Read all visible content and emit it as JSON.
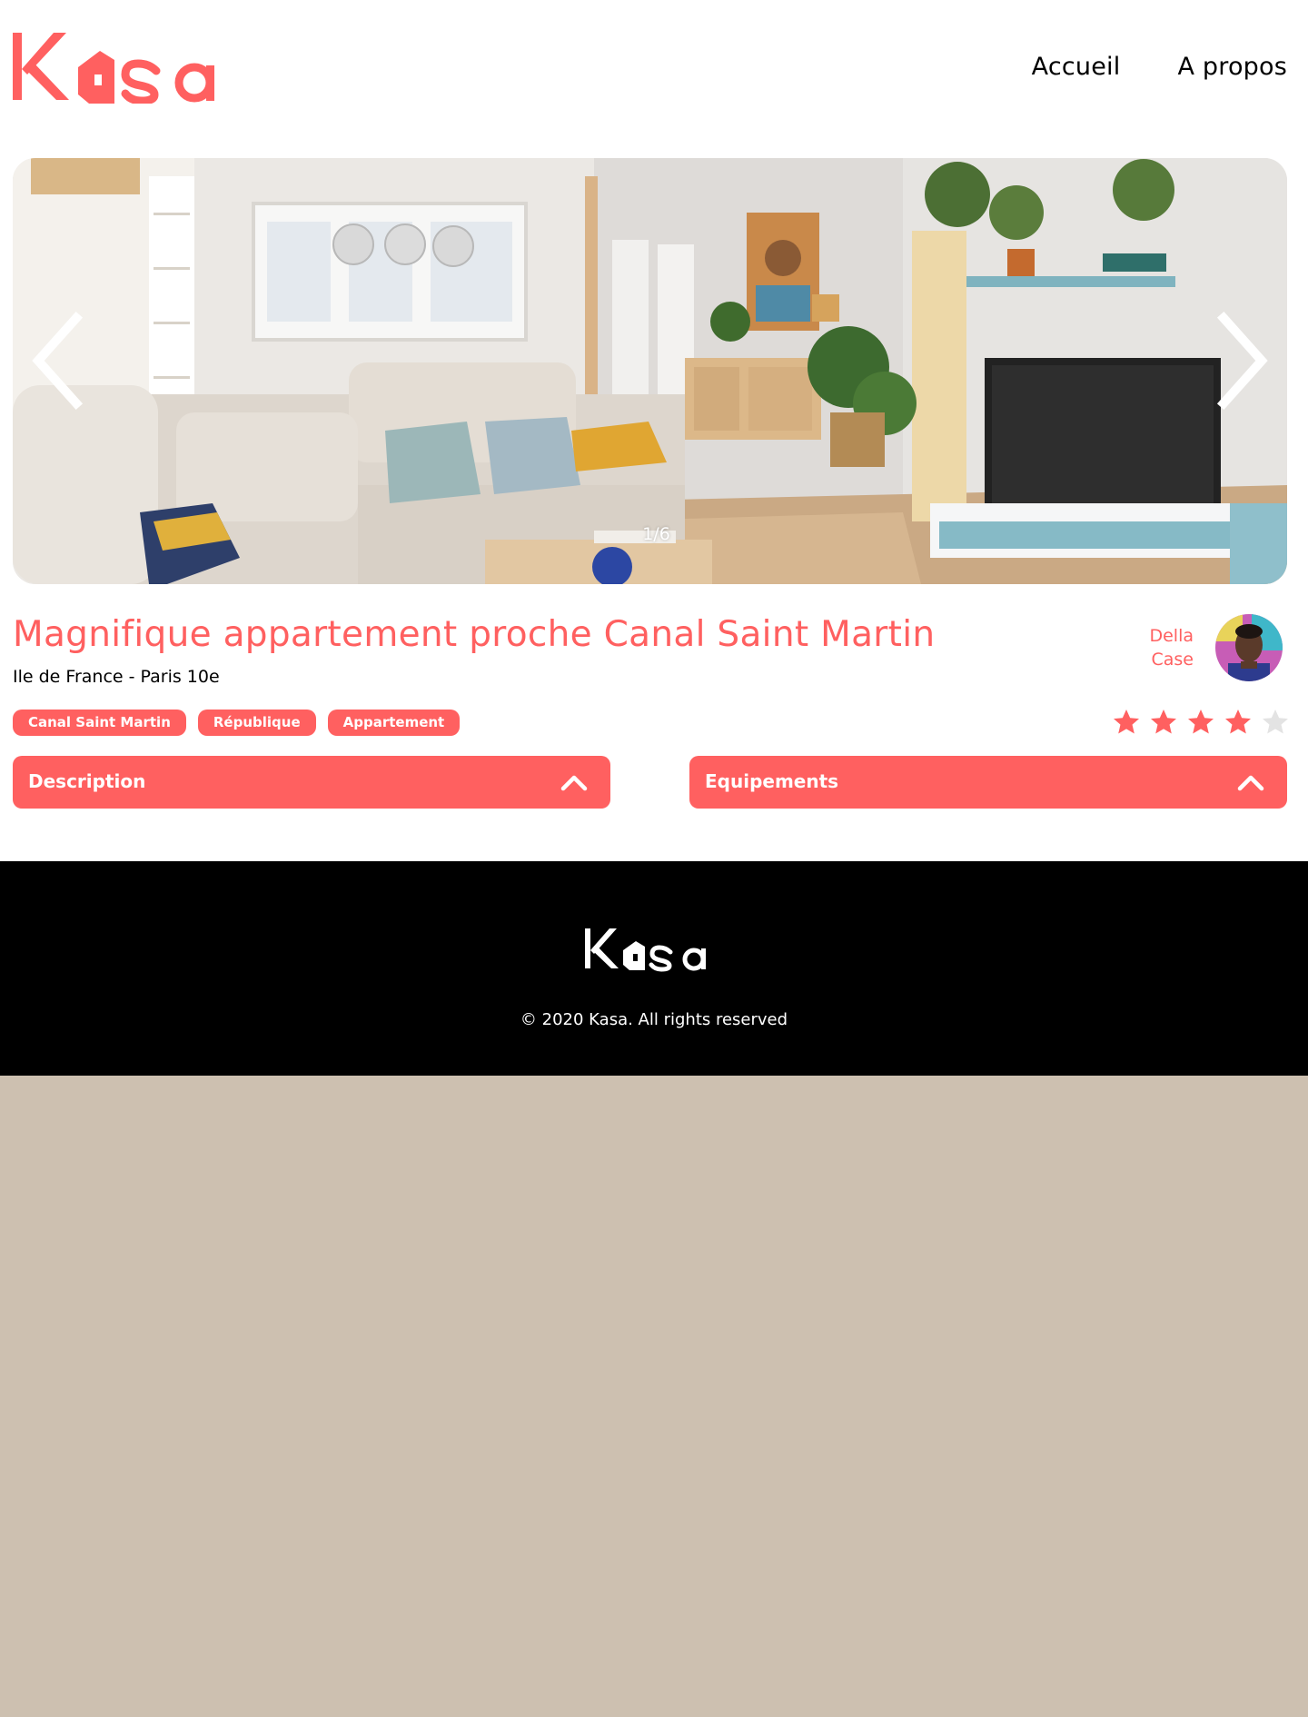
{
  "brand": {
    "name": "Kasa",
    "accent_color": "#ff6060"
  },
  "nav": {
    "home_label": "Accueil",
    "about_label": "A propos"
  },
  "gallery": {
    "counter": "1/6",
    "current": 1,
    "total": 6,
    "prev_icon": "chevron-left-icon",
    "next_icon": "chevron-right-icon"
  },
  "listing": {
    "title": "Magnifique appartement proche Canal Saint Martin",
    "location": "Ile de France - Paris 10e",
    "tags": [
      "Canal Saint Martin",
      "République",
      "Appartement"
    ],
    "rating": 4,
    "rating_max": 5
  },
  "host": {
    "first_name": "Della",
    "last_name": "Case"
  },
  "collapses": {
    "description_label": "Description",
    "equipments_label": "Equipements",
    "icon": "chevron-up-icon"
  },
  "footer": {
    "copyright": "© 2020 Kasa. All rights reserved"
  },
  "colors": {
    "accent": "#ff6060",
    "star_off": "#e3e3e3",
    "footer_bg": "#000000",
    "backdrop": "#cdc0b0"
  }
}
